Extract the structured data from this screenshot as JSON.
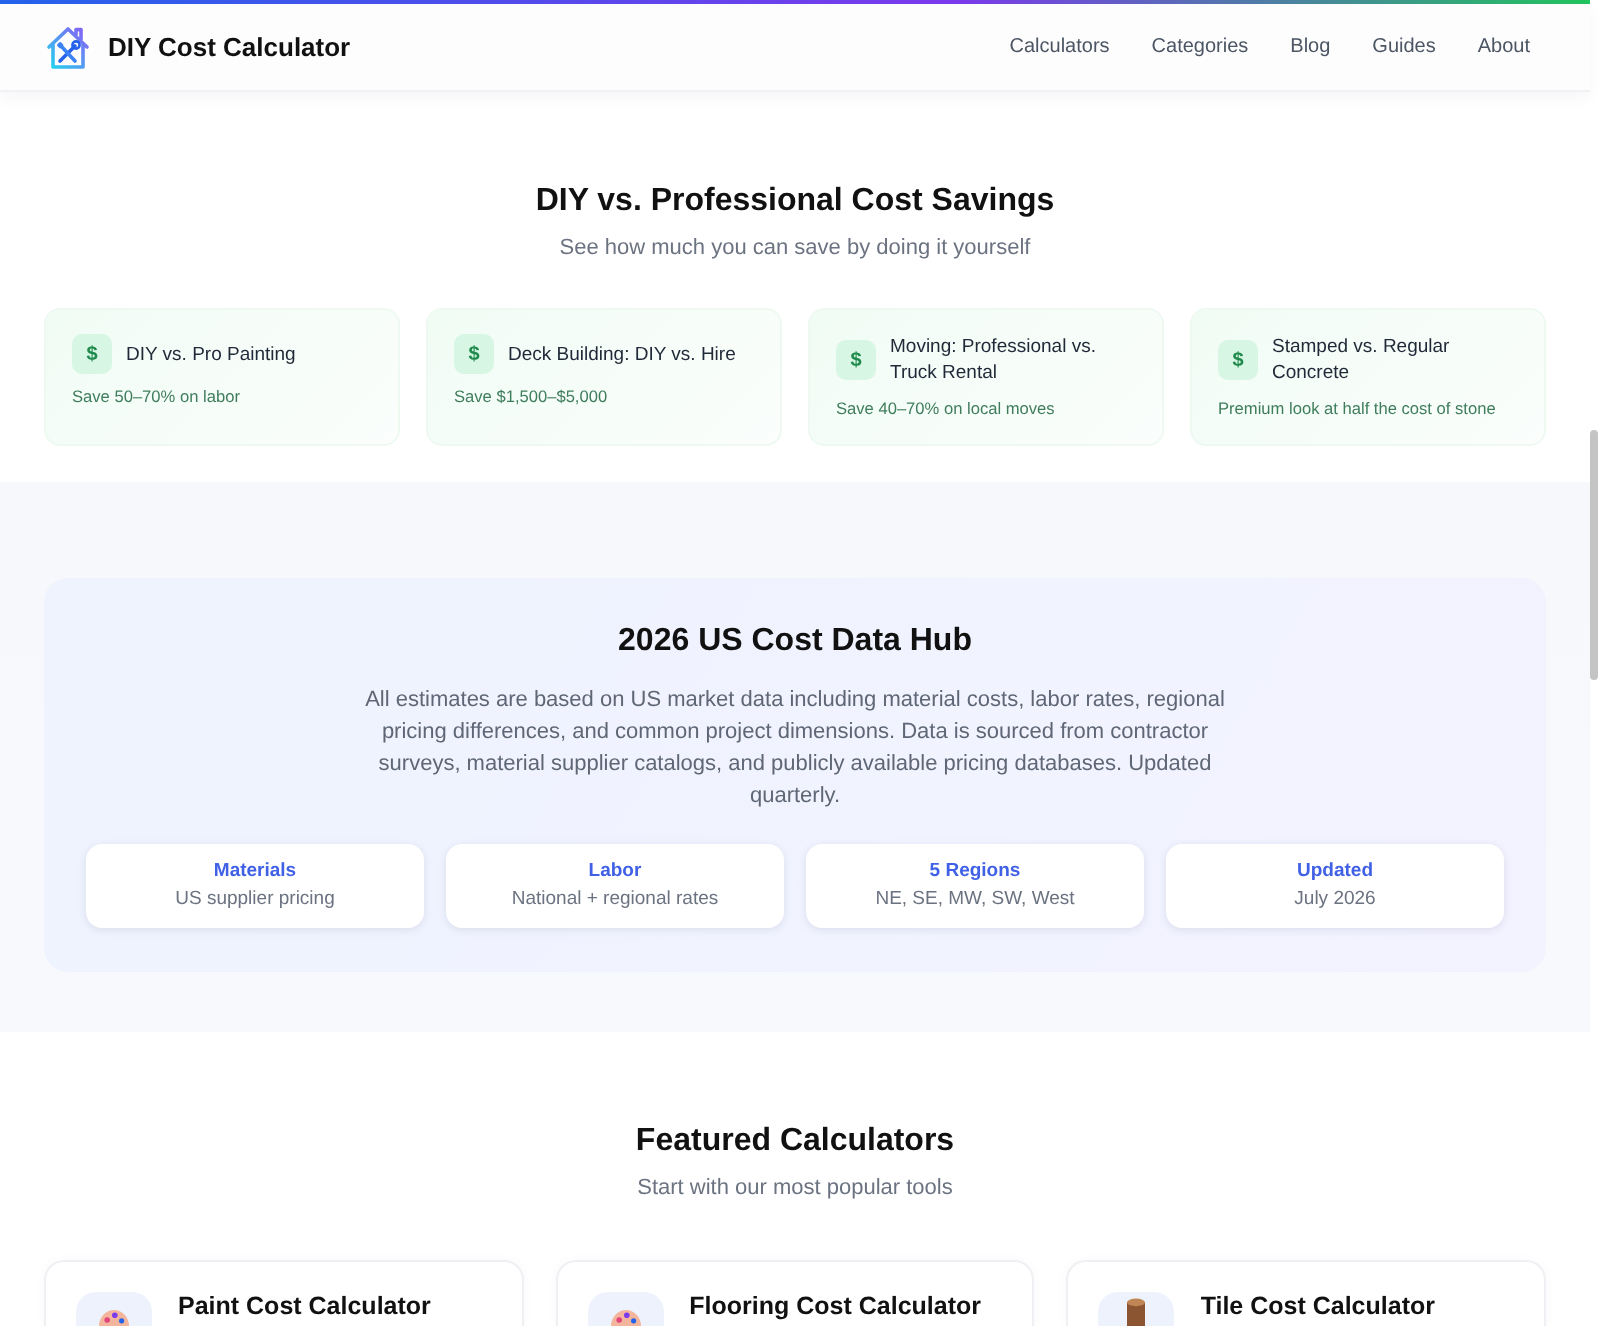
{
  "header": {
    "brand": "DIY Cost Calculator",
    "nav": [
      {
        "label": "Calculators"
      },
      {
        "label": "Categories"
      },
      {
        "label": "Blog"
      },
      {
        "label": "Guides"
      },
      {
        "label": "About"
      }
    ]
  },
  "savings": {
    "title": "DIY vs. Professional Cost Savings",
    "subtitle": "See how much you can save by doing it yourself",
    "cards": [
      {
        "icon": "$",
        "title": "DIY vs. Pro Painting",
        "note": "Save 50–70% on labor"
      },
      {
        "icon": "$",
        "title": "Deck Building: DIY vs. Hire",
        "note": "Save $1,500–$5,000"
      },
      {
        "icon": "$",
        "title": "Moving: Professional vs. Truck Rental",
        "note": "Save 40–70% on local moves"
      },
      {
        "icon": "$",
        "title": "Stamped vs. Regular Concrete",
        "note": "Premium look at half the cost of stone"
      }
    ]
  },
  "data_hub": {
    "title": "2026 US Cost Data Hub",
    "description": "All estimates are based on US market data including material costs, labor rates, regional pricing differences, and common project dimensions. Data is sourced from contractor surveys, material supplier catalogs, and publicly available pricing databases. Updated quarterly.",
    "stats": [
      {
        "label": "Materials",
        "value": "US supplier pricing"
      },
      {
        "label": "Labor",
        "value": "National + regional rates"
      },
      {
        "label": "5 Regions",
        "value": "NE, SE, MW, SW, West"
      },
      {
        "label": "Updated",
        "value": "July 2026"
      }
    ]
  },
  "featured": {
    "title": "Featured Calculators",
    "subtitle": "Start with our most popular tools",
    "calculators": [
      {
        "kind": "palette",
        "title": "Paint Cost Calculator"
      },
      {
        "kind": "palette",
        "title": "Flooring Cost Calculator"
      },
      {
        "kind": "wood",
        "title": "Tile Cost Calculator"
      }
    ]
  }
}
